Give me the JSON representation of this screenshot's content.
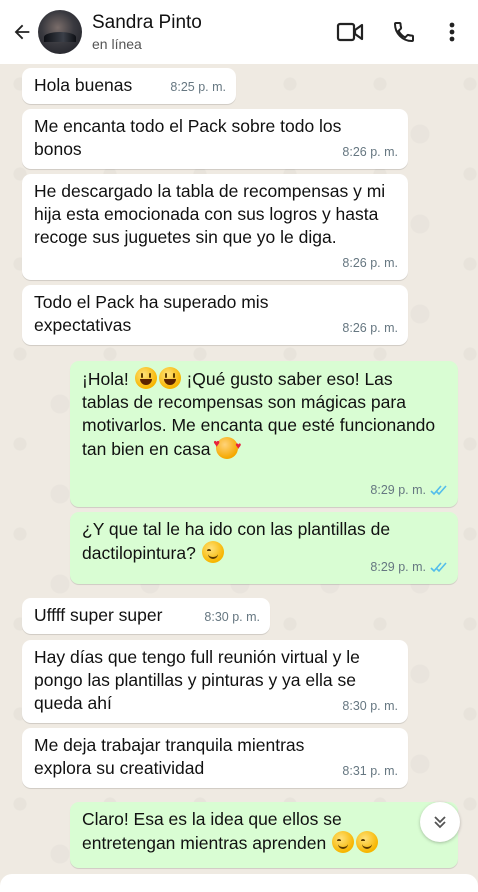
{
  "header": {
    "name": "Sandra Pinto",
    "status": "en línea"
  },
  "messages": [
    {
      "dir": "in",
      "text": "Hola buenas",
      "time": "8:25 p. m."
    },
    {
      "dir": "in",
      "text": "Me encanta todo el Pack sobre todo los bonos",
      "time": "8:26 p. m."
    },
    {
      "dir": "in",
      "text": "He descargado la tabla de recompensas y mi hija esta emocionada con sus logros y hasta recoge sus juguetes sin que yo le diga.",
      "time": "8:26 p. m."
    },
    {
      "dir": "in",
      "text": "Todo el Pack ha superado mis expectativas",
      "time": "8:26 p. m."
    },
    {
      "dir": "out",
      "text_a": "¡Hola!",
      "text_b": "¡Qué gusto saber eso! Las tablas de recompensas son mágicas para motivarlos. Me encanta que esté funcionando tan bien en casa",
      "time": "8:29 p. m."
    },
    {
      "dir": "out",
      "text": "¿Y que tal le ha ido con las plantillas de dactilopintura?",
      "time": "8:29 p. m."
    },
    {
      "dir": "in",
      "text": "Uffff super super",
      "time": "8:30 p. m."
    },
    {
      "dir": "in",
      "text": "Hay días que tengo full reunión virtual y le pongo las plantillas y pinturas y ya ella se queda ahí",
      "time": "8:30 p. m."
    },
    {
      "dir": "in",
      "text": "Me deja trabajar tranquila mientras explora su creatividad",
      "time": "8:31 p. m."
    },
    {
      "dir": "out",
      "text": "Claro! Esa es la idea que ellos se entretengan mientras aprenden"
    }
  ],
  "colors": {
    "incoming": "#ffffff",
    "outgoing": "#d9fdd3",
    "read_ticks": "#53bdeb",
    "background": "#efeae2"
  },
  "icons": [
    "back-arrow-icon",
    "video-call-icon",
    "phone-icon",
    "more-options-icon",
    "double-check-icon",
    "chevron-double-down-icon"
  ]
}
